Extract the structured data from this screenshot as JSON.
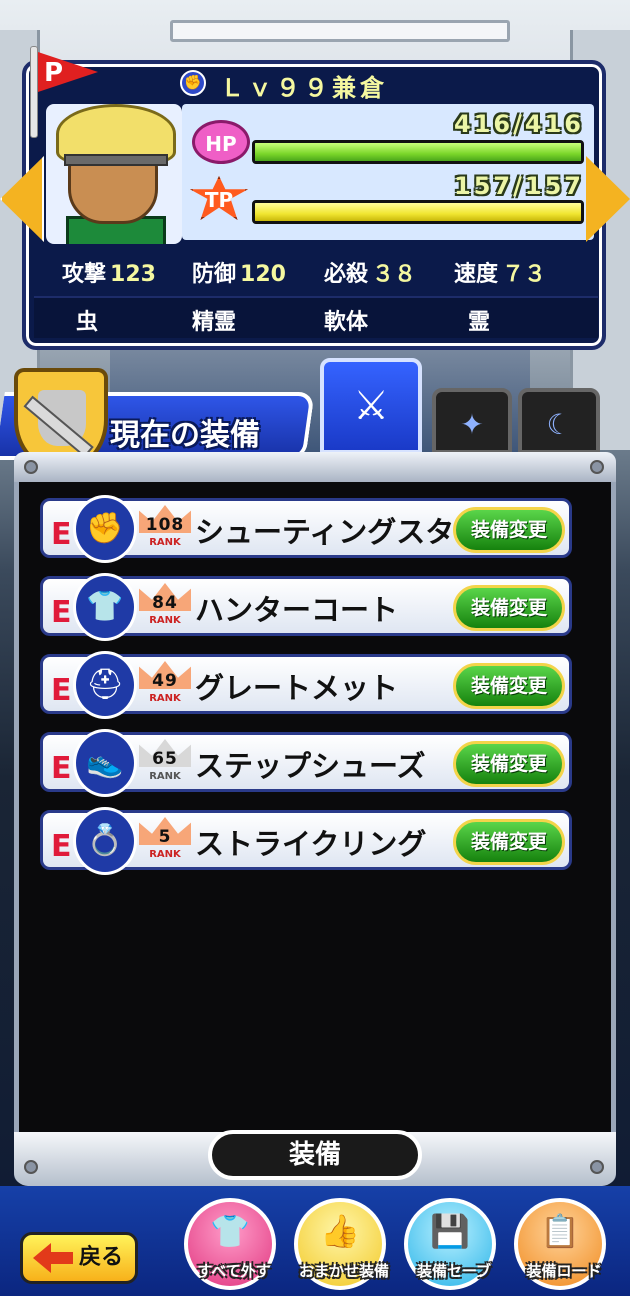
{
  "character": {
    "level_label": "Ｌｖ９９",
    "name": "兼倉",
    "hp_label": "HP",
    "hp_text": "416/416",
    "hp_fraction": 1.0,
    "tp_label": "TP",
    "tp_text": "157/157",
    "tp_fraction": 1.0,
    "stats": [
      {
        "label": "攻撃",
        "value": "123"
      },
      {
        "label": "防御",
        "value": "120"
      },
      {
        "label": "必殺",
        "value": "３８"
      },
      {
        "label": "速度",
        "value": "７３"
      }
    ],
    "types": [
      "虫",
      "精霊",
      "軟体",
      "霊"
    ]
  },
  "flag_letter": "P",
  "section": {
    "title": "現在の装備",
    "tabs": [
      {
        "icon": "shirt-sword-icon",
        "active": true
      },
      {
        "icon": "sparkle-icon",
        "active": false
      },
      {
        "icon": "crescent-icon",
        "active": false
      }
    ]
  },
  "equipment": [
    {
      "grade": "E",
      "icon": "knuckle-icon",
      "rank_num": "108",
      "rank_label": "RANK",
      "rank_color": "bronze",
      "name": "シューティングスター",
      "button": "装備変更"
    },
    {
      "grade": "E",
      "icon": "shirt-icon",
      "rank_num": "84",
      "rank_label": "RANK",
      "rank_color": "bronze",
      "name": "ハンターコート",
      "button": "装備変更"
    },
    {
      "grade": "E",
      "icon": "helmet-icon",
      "rank_num": "49",
      "rank_label": "RANK",
      "rank_color": "bronze",
      "name": "グレートメット",
      "button": "装備変更"
    },
    {
      "grade": "E",
      "icon": "shoe-icon",
      "rank_num": "65",
      "rank_label": "RANK",
      "rank_color": "silver",
      "name": "ステップシューズ",
      "button": "装備変更"
    },
    {
      "grade": "E",
      "icon": "ring-icon",
      "rank_num": "5",
      "rank_label": "RANK",
      "rank_color": "bronze",
      "name": "ストライクリング",
      "button": "装備変更"
    }
  ],
  "equip_label": "装備",
  "footer": {
    "back_label": "戻る",
    "buttons": [
      {
        "label": "すべて外す",
        "icon": "unequip-icon"
      },
      {
        "label": "おまかせ装備",
        "icon": "thumbs-up-icon"
      },
      {
        "label": "装備セーブ",
        "icon": "save-icon"
      },
      {
        "label": "装備ロード",
        "icon": "load-icon"
      }
    ]
  },
  "colors": {
    "accent": "#2f56e8",
    "button_green": "#16820e",
    "grade": "#e01a3a"
  }
}
